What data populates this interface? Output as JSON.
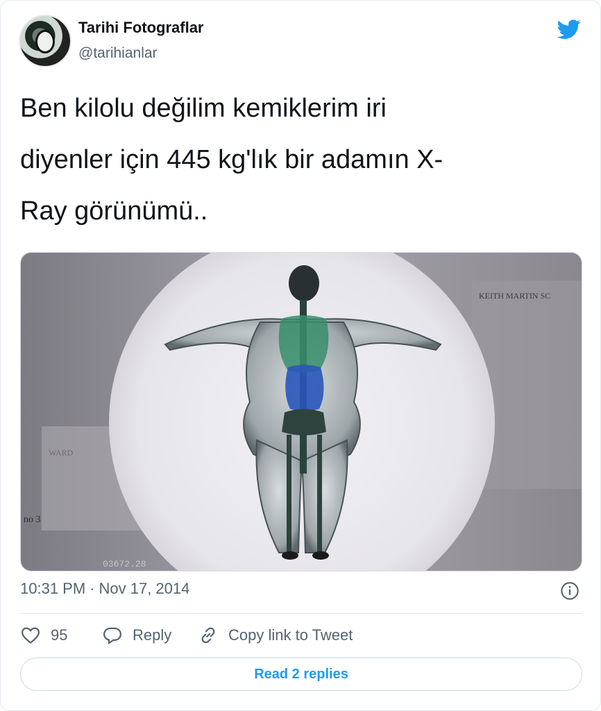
{
  "author": {
    "name": "Tarihi Fotograflar",
    "handle": "@tarihianlar"
  },
  "tweet": {
    "text_line1": "Ben kilolu değilim kemiklerim iri",
    "text_line2": "diyenler için 445 kg'lık bir adamın X-",
    "text_line3": "Ray görünümü..",
    "time": "10:31 PM",
    "separator": "·",
    "date": "Nov 17, 2014"
  },
  "media": {
    "overlay_label_top_right": "KEITH  MARTIN  SC",
    "overlay_label_left": "WARD",
    "overlay_counter": "03672.28",
    "overlay_no": "no 3"
  },
  "actions": {
    "like_count": "95",
    "reply_label": "Reply",
    "copy_link_label": "Copy link to Tweet"
  },
  "footer": {
    "read_replies_label": "Read 2 replies"
  },
  "colors": {
    "accent": "#1d9bf0",
    "text_primary": "#0f1419",
    "text_secondary": "#536471",
    "border": "#cfd9de"
  },
  "icons": {
    "brand": "twitter-bird-icon",
    "info": "info-icon",
    "like": "heart-icon",
    "reply": "speech-bubble-icon",
    "copy_link": "link-icon"
  }
}
